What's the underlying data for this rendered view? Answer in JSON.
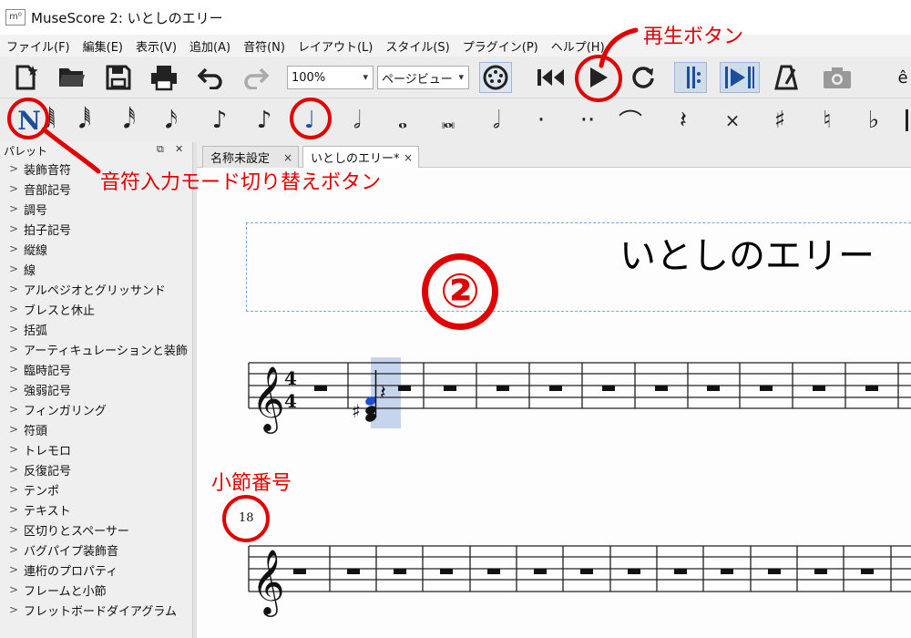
{
  "window": {
    "app_icon": "m⁰",
    "title": "MuseScore 2: いとしのエリー"
  },
  "menu": [
    "ファイル(F)",
    "編集(E)",
    "表示(V)",
    "追加(A)",
    "音符(N)",
    "レイアウト(L)",
    "スタイル(S)",
    "プラグイン(P)",
    "ヘルプ(H)"
  ],
  "toolbar": {
    "zoom_value": "100%",
    "view_mode": "ページビュー",
    "icons": [
      "new-score-icon",
      "open-folder-icon",
      "save-icon",
      "print-icon",
      "undo-icon",
      "redo-icon",
      "midi-input-icon",
      "rewind-icon",
      "play-icon",
      "loop-icon",
      "loop-in-out-icon",
      "play-repeats-icon",
      "metronome-icon",
      "image-capture-icon"
    ],
    "far_right_glyph": "ê"
  },
  "note_input": {
    "mode_glyph": "N",
    "durations": [
      "𝅘𝅥𝅱",
      "𝅘𝅥𝅰",
      "𝅘𝅥𝅯",
      "♪",
      "♪",
      "♩",
      "𝅗𝅥",
      "𝅝",
      "𝅜",
      "𝅗𝅥",
      "·",
      "··",
      "⌒",
      "𝄽",
      "×",
      "♯",
      "♮",
      "♭"
    ],
    "first_partial": "𝅘𝅥𝅲"
  },
  "palette": {
    "title": "パレット",
    "items": [
      "装飾音符",
      "音部記号",
      "調号",
      "拍子記号",
      "縦線",
      "線",
      "アルペジオとグリッサンド",
      "ブレスと休止",
      "括弧",
      "アーティキュレーションと装飾",
      "臨時記号",
      "強弱記号",
      "フィンガリング",
      "符頭",
      "トレモロ",
      "反復記号",
      "テンポ",
      "テキスト",
      "区切りとスペーサー",
      "バグパイプ装飾音",
      "連桁のプロパティ",
      "フレームと小節",
      "フレットボードダイアグラム"
    ]
  },
  "tabs": [
    {
      "label": "名称未設定",
      "close": "×"
    },
    {
      "label": "いとしのエリー*",
      "close": "×"
    }
  ],
  "score": {
    "title": "いとしのエリー",
    "step_marker": "②",
    "time_sig_top": "4",
    "time_sig_bottom": "4",
    "sharp": "♯",
    "measure_number": "18"
  },
  "annotations": {
    "play_button": "再生ボタン",
    "note_input_toggle": "音符入力モード切り替えボタン",
    "measure_number": "小節番号"
  },
  "colors": {
    "accent_red": "#e10000",
    "selection_blue": "#c7d4ee",
    "note_blue": "#1a4fd6"
  }
}
